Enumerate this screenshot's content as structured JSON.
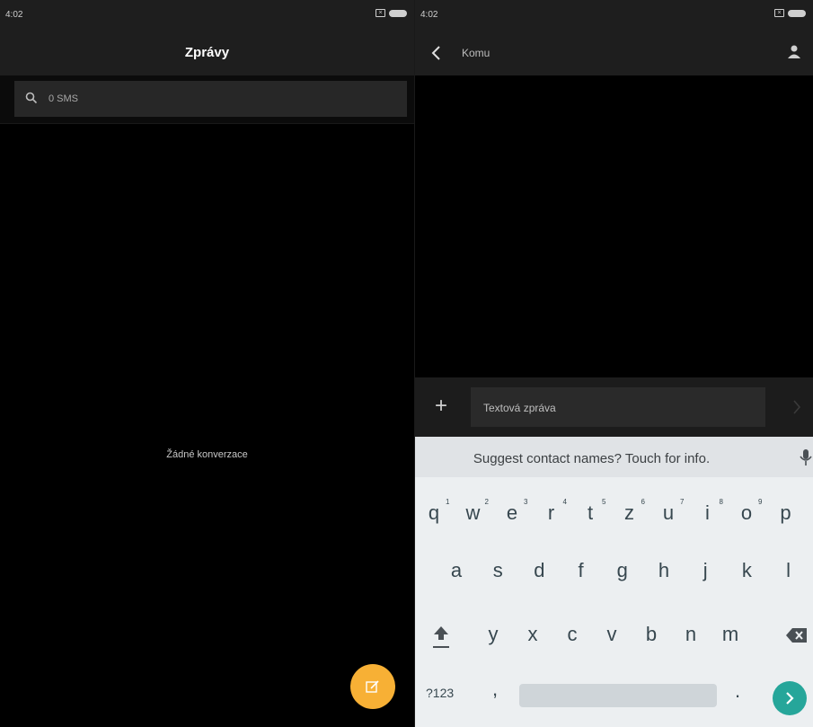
{
  "left_screen": {
    "status_time": "4:02",
    "title": "Zprávy",
    "search_placeholder": "0 SMS",
    "empty_text": "Žádné konverzace",
    "fab_color": "#f7b035",
    "icons": [
      "search-icon",
      "compose-icon",
      "sim-icon",
      "battery-icon"
    ]
  },
  "right_screen": {
    "status_time": "4:02",
    "to_placeholder": "Komu",
    "composer_plus": "+",
    "composer_placeholder": "Textová zpráva",
    "icons": [
      "back-icon",
      "contact-icon",
      "send-icon",
      "mic-icon",
      "shift-icon",
      "delete-icon",
      "enter-icon"
    ]
  },
  "keyboard": {
    "suggestion": "Suggest contact names? Touch for info.",
    "row1": [
      "q",
      "w",
      "e",
      "r",
      "t",
      "z",
      "u",
      "i",
      "o",
      "p"
    ],
    "row1_hints": [
      "1",
      "2",
      "3",
      "4",
      "5",
      "6",
      "7",
      "8",
      "9"
    ],
    "row2": [
      "a",
      "s",
      "d",
      "f",
      "g",
      "h",
      "j",
      "k",
      "l"
    ],
    "row3": [
      "y",
      "x",
      "c",
      "v",
      "b",
      "n",
      "m"
    ],
    "symbols_label": "?123",
    "comma": ",",
    "period": ".",
    "enter_color": "#26a69a"
  }
}
